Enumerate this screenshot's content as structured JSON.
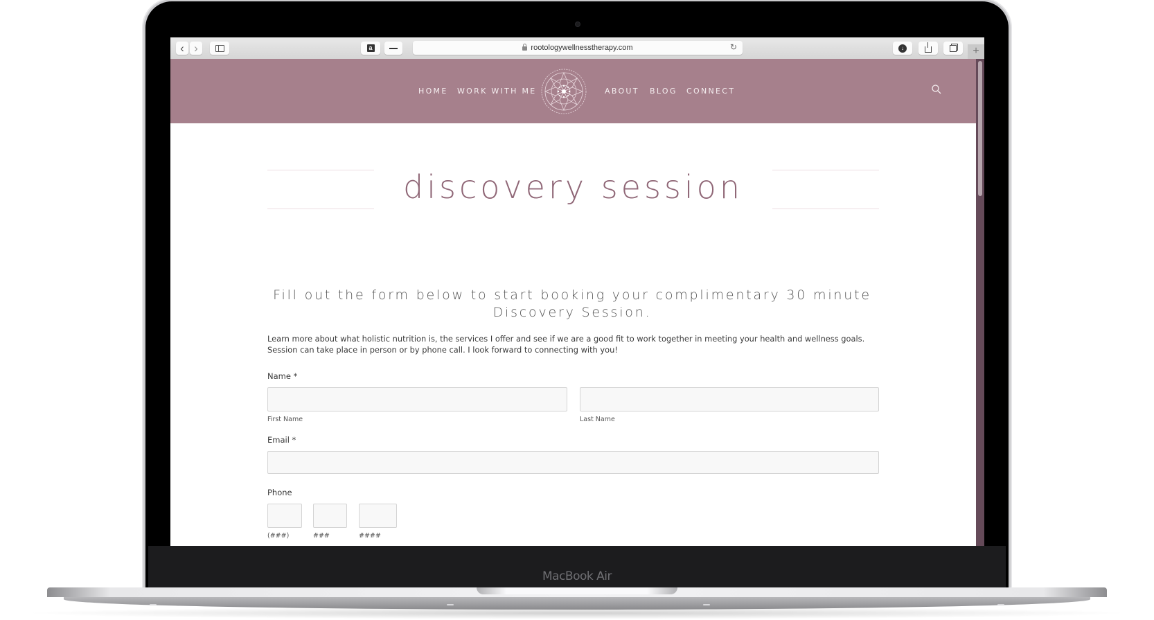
{
  "device": {
    "brand_label": "MacBook Air"
  },
  "browser": {
    "url": "rootologywellnesstherapy.com",
    "toolbar_icons": {
      "back": "chevron-left-icon",
      "forward": "chevron-right-icon",
      "sidebar": "sidebar-icon",
      "extension": "amazon-icon",
      "extension2": "minus-icon",
      "reload": "reload-icon",
      "downloads": "download-icon",
      "share": "share-icon",
      "tabs": "tabs-icon",
      "new_tab": "+"
    },
    "glyphs": {
      "back": "‹",
      "forward": "›",
      "amazon": "a",
      "minus": "—",
      "reload": "↻",
      "download": "⬇",
      "share": "⇪",
      "tabs": "❐"
    }
  },
  "site": {
    "colors": {
      "header_bg": "#a6808c",
      "title": "#8f6676",
      "scrollbar": "#654a59"
    },
    "nav_left": [
      "HOME",
      "WORK WITH ME"
    ],
    "nav_right": [
      "ABOUT",
      "BLOG",
      "CONNECT"
    ],
    "logo": "mandala-logo",
    "search_icon": "search-icon"
  },
  "page": {
    "title": "discovery session",
    "subheading": "Fill out the form below to start booking your complimentary 30 minute Discovery Session.",
    "intro": "Learn more about what holistic nutrition is, the services I offer and see if we are a good fit to work together in meeting your health and wellness goals. Session can take place in person or by phone call. I look forward to connecting with you!"
  },
  "form": {
    "name_label": "Name *",
    "first_name_sublabel": "First Name",
    "first_name_value": "",
    "last_name_sublabel": "Last Name",
    "last_name_value": "",
    "email_label": "Email *",
    "email_value": "",
    "phone_label": "Phone",
    "phone_area_sublabel": "(###)",
    "phone_prefix_sublabel": "###",
    "phone_line_sublabel": "####",
    "phone_area_value": "",
    "phone_prefix_value": "",
    "phone_line_value": ""
  }
}
